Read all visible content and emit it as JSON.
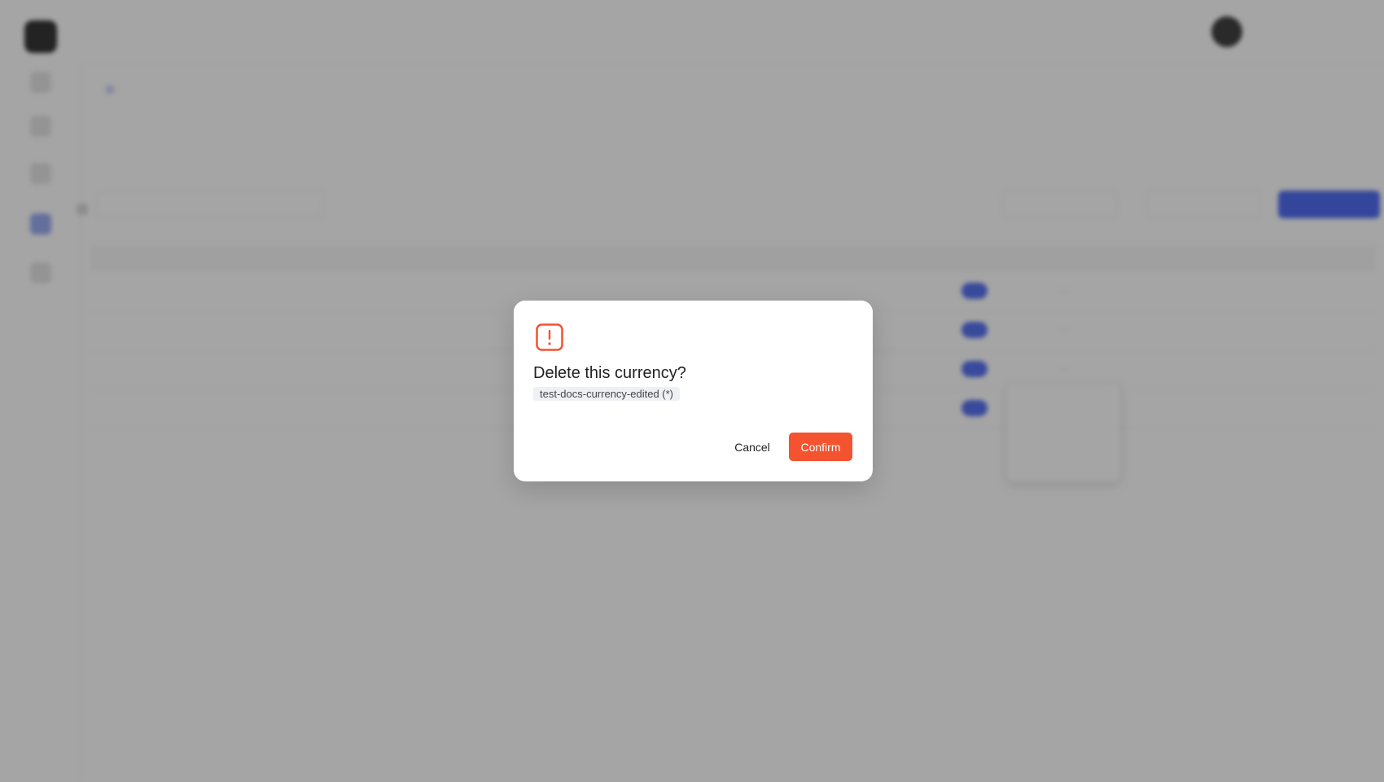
{
  "app": {
    "user": {
      "name": "",
      "role": ""
    },
    "breadcrumb": {
      "label": ""
    },
    "page": {
      "title": "",
      "description": ""
    },
    "toolbar": {
      "search_placeholder": "",
      "filter_1": "",
      "filter_2": "",
      "primary_button": ""
    },
    "table": {
      "columns": [
        "",
        "",
        "",
        "",
        "",
        "",
        "",
        ""
      ],
      "rows": [
        {
          "cells": [
            "",
            "",
            "",
            "",
            "",
            "",
            "",
            ""
          ]
        },
        {
          "cells": [
            "",
            "",
            "",
            "",
            "",
            "",
            "",
            ""
          ]
        },
        {
          "cells": [
            "",
            "",
            "",
            "",
            "",
            "",
            "",
            ""
          ]
        },
        {
          "cells": [
            "",
            "",
            "",
            "",
            "",
            "",
            "",
            ""
          ]
        }
      ]
    },
    "row_menu": {
      "items": [
        "",
        "",
        ""
      ]
    }
  },
  "modal": {
    "icon": "warning-icon",
    "title": "Delete this currency?",
    "item_tag": "test-docs-currency-edited (*)",
    "cancel_label": "Cancel",
    "confirm_label": "Confirm"
  },
  "colors": {
    "accent": "#f4532f",
    "primary_blue": "#3d5cf0"
  }
}
